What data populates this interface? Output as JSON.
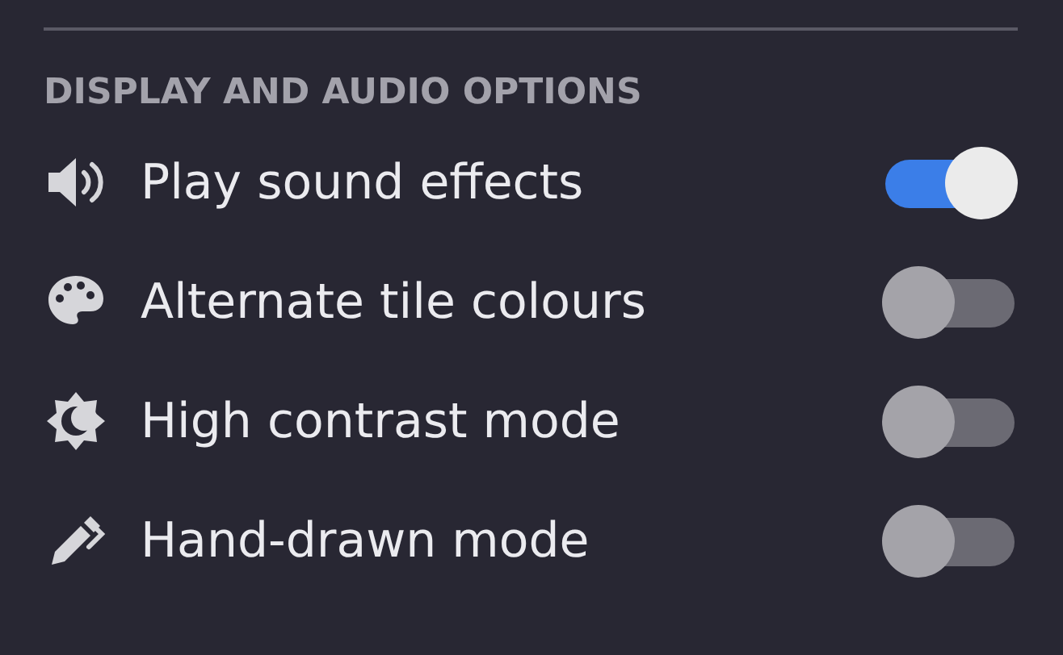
{
  "section": {
    "heading": "DISPLAY AND AUDIO OPTIONS"
  },
  "options": [
    {
      "kind": "sound",
      "label": "Play sound effects",
      "on": true
    },
    {
      "kind": "palette",
      "label": "Alternate tile colours",
      "on": false
    },
    {
      "kind": "contrast",
      "label": "High contrast mode",
      "on": false
    },
    {
      "kind": "pen",
      "label": "Hand-drawn mode",
      "on": false
    }
  ]
}
